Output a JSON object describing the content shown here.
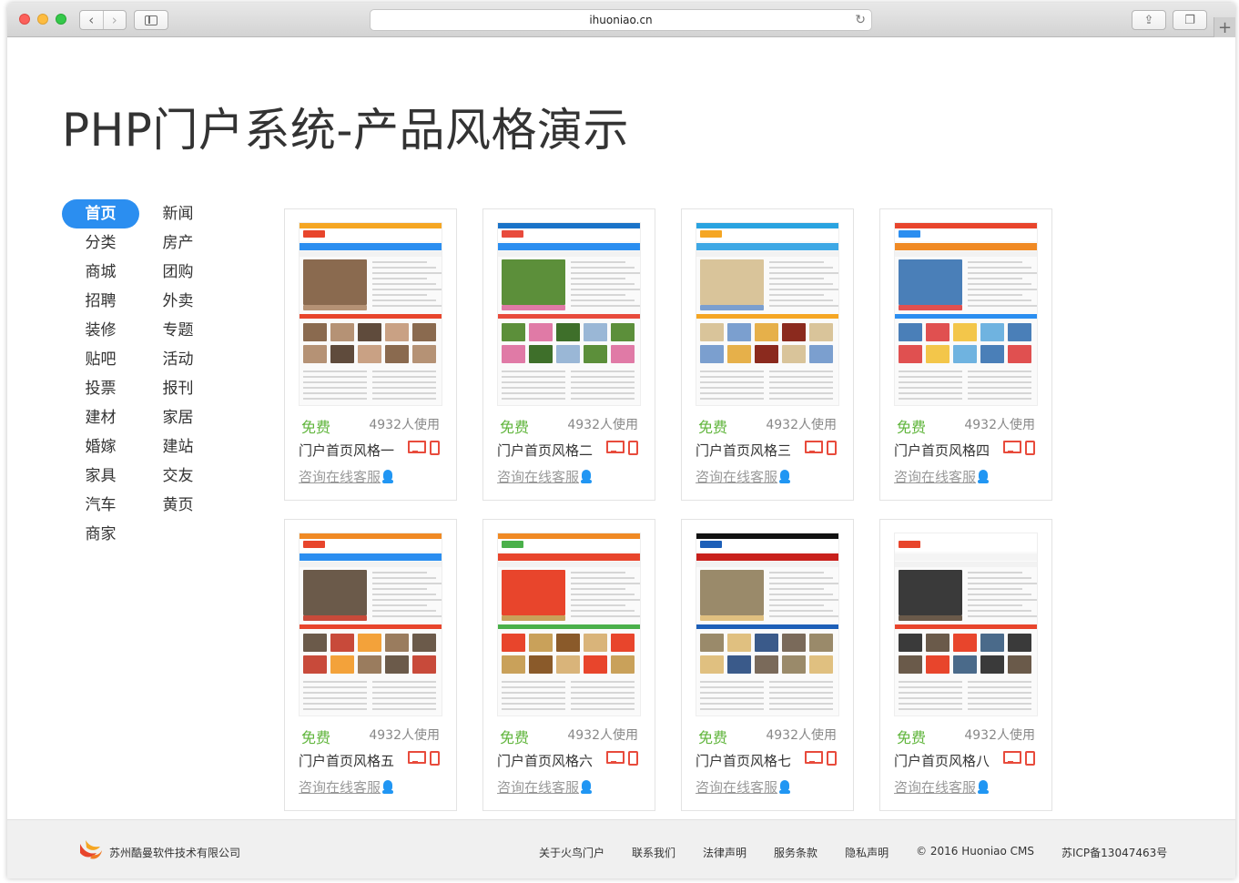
{
  "browser": {
    "url": "ihuoniao.cn"
  },
  "page": {
    "title": "PHP门户系统-产品风格演示"
  },
  "categories": [
    "首页",
    "新闻",
    "分类",
    "房产",
    "商城",
    "团购",
    "招聘",
    "外卖",
    "装修",
    "专题",
    "贴吧",
    "活动",
    "投票",
    "报刊",
    "建材",
    "家居",
    "婚嫁",
    "建站",
    "家具",
    "交友",
    "汽车",
    "黄页",
    "商家"
  ],
  "active_category": "首页",
  "cards": [
    {
      "free": "免费",
      "usage": "4932人使用",
      "name": "门户首页风格一",
      "consult": "咨询在线客服"
    },
    {
      "free": "免费",
      "usage": "4932人使用",
      "name": "门户首页风格二",
      "consult": "咨询在线客服"
    },
    {
      "free": "免费",
      "usage": "4932人使用",
      "name": "门户首页风格三",
      "consult": "咨询在线客服"
    },
    {
      "free": "免费",
      "usage": "4932人使用",
      "name": "门户首页风格四",
      "consult": "咨询在线客服"
    },
    {
      "free": "免费",
      "usage": "4932人使用",
      "name": "门户首页风格五",
      "consult": "咨询在线客服"
    },
    {
      "free": "免费",
      "usage": "4932人使用",
      "name": "门户首页风格六",
      "consult": "咨询在线客服"
    },
    {
      "free": "免费",
      "usage": "4932人使用",
      "name": "门户首页风格七",
      "consult": "咨询在线客服"
    },
    {
      "free": "免费",
      "usage": "4932人使用",
      "name": "门户首页风格八",
      "consult": "咨询在线客服"
    }
  ],
  "footer": {
    "company": "苏州酷曼软件技术有限公司",
    "links": [
      "关于火鸟门户",
      "联系我们",
      "法律声明",
      "服务条款",
      "隐私声明",
      "© 2016 Huoniao CMS",
      "苏ICP备13047463号"
    ]
  },
  "colors": {
    "accent": "#2b8ef0",
    "free_green": "#60b53c",
    "device_red": "#e84b3c",
    "qq_blue": "#2196f3"
  }
}
